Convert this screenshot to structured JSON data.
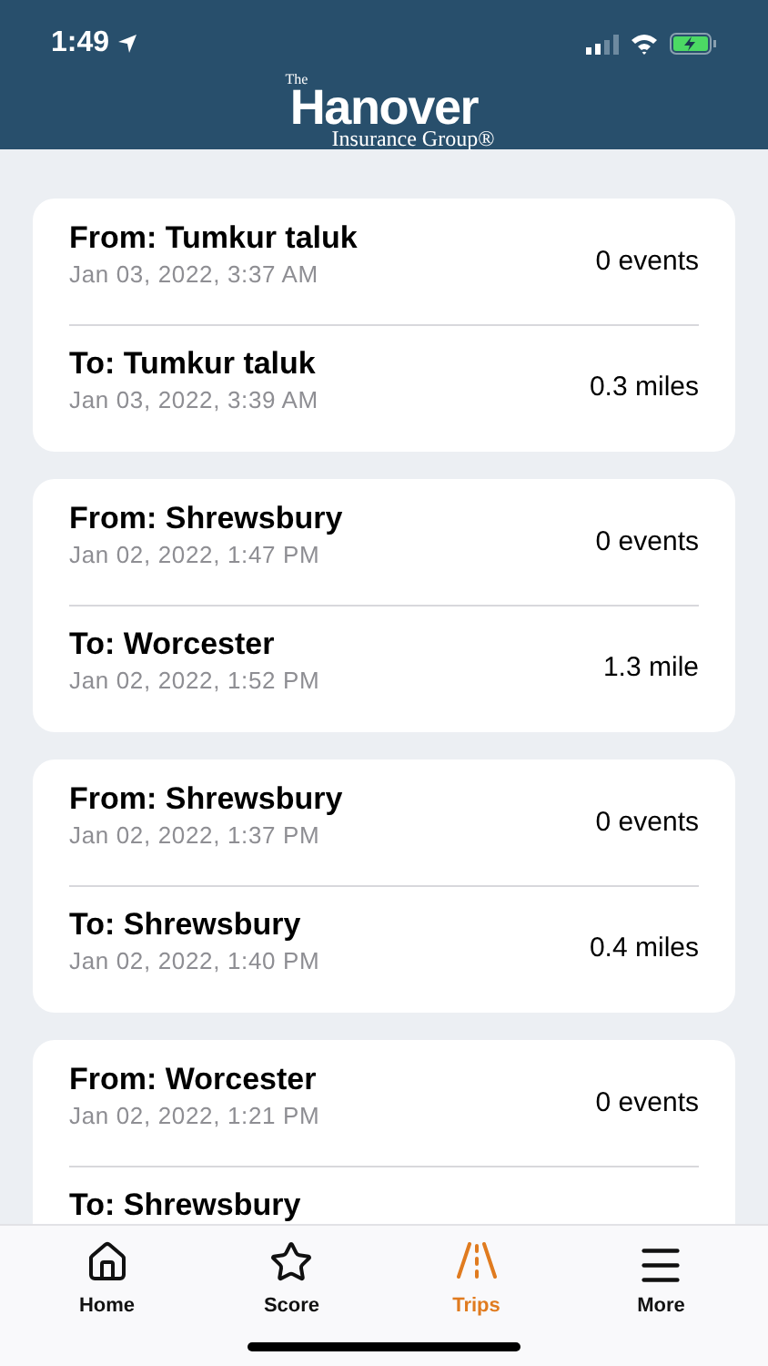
{
  "status_bar": {
    "time": "1:49"
  },
  "header": {
    "logo": {
      "small": "The",
      "main": "Hanover",
      "sub": "Insurance Group®"
    }
  },
  "trips": [
    {
      "from": {
        "place": "From: Tumkur taluk",
        "time": "Jan 03, 2022, 3:37 AM",
        "info": "0 events"
      },
      "to": {
        "place": "To: Tumkur taluk",
        "time": "Jan 03, 2022, 3:39 AM",
        "info": "0.3 miles"
      }
    },
    {
      "from": {
        "place": "From: Shrewsbury",
        "time": "Jan 02, 2022, 1:47 PM",
        "info": "0 events"
      },
      "to": {
        "place": "To: Worcester",
        "time": "Jan 02, 2022, 1:52 PM",
        "info": "1.3 mile"
      }
    },
    {
      "from": {
        "place": "From: Shrewsbury",
        "time": "Jan 02, 2022, 1:37 PM",
        "info": "0 events"
      },
      "to": {
        "place": "To: Shrewsbury",
        "time": "Jan 02, 2022, 1:40 PM",
        "info": "0.4 miles"
      }
    },
    {
      "from": {
        "place": "From: Worcester",
        "time": "Jan 02, 2022, 1:21 PM",
        "info": "0 events"
      },
      "to": {
        "place": "To: Shrewsbury"
      }
    }
  ],
  "tab_bar": [
    {
      "kind": "home",
      "label": "Home",
      "selected": false
    },
    {
      "kind": "score",
      "label": "Score",
      "selected": false
    },
    {
      "kind": "trips",
      "label": "Trips",
      "selected": true
    },
    {
      "kind": "more",
      "label": "More",
      "selected": false
    }
  ]
}
